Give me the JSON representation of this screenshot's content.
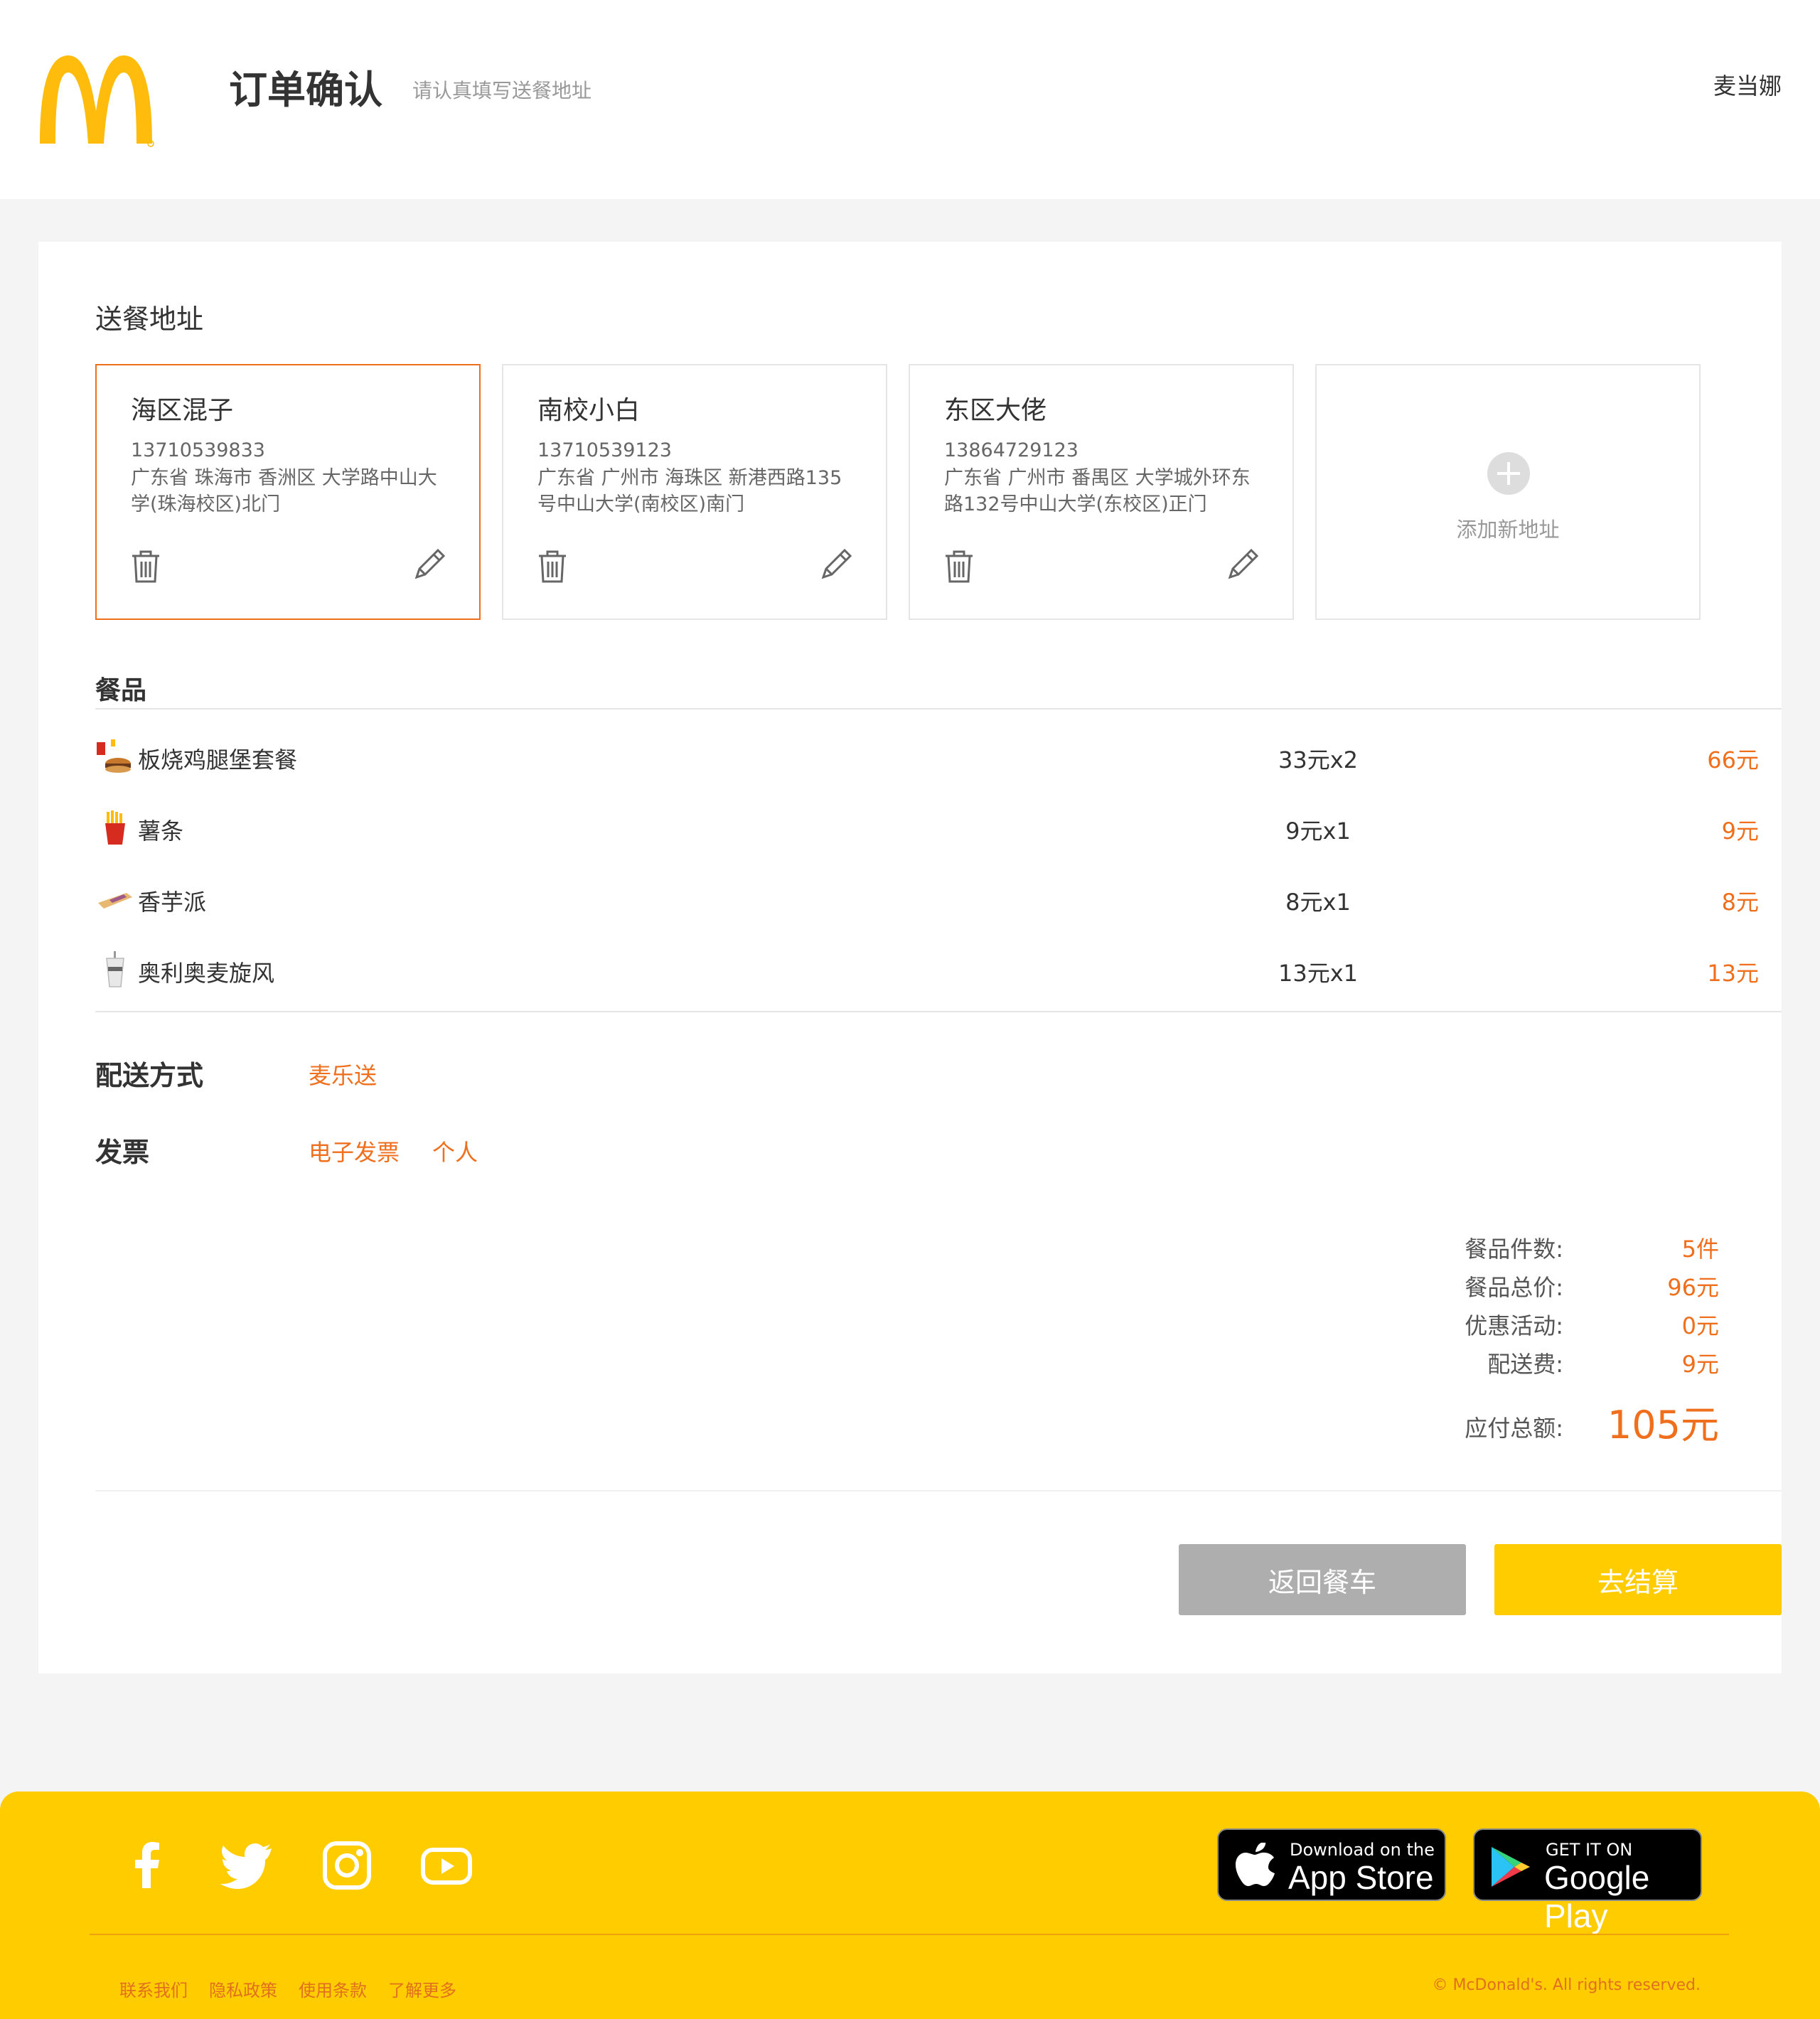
{
  "header": {
    "title": "订单确认",
    "subtitle": "请认真填写送餐地址",
    "username": "麦当娜"
  },
  "address": {
    "section_title": "送餐地址",
    "cards": [
      {
        "name": "海区混子",
        "phone": "13710539833",
        "address": "广东省 珠海市 香洲区 大学路中山大学(珠海校区)北门",
        "selected": true
      },
      {
        "name": "南校小白",
        "phone": "13710539123",
        "address": "广东省 广州市 海珠区 新港西路135号中山大学(南校区)南门",
        "selected": false
      },
      {
        "name": "东区大佬",
        "phone": "13864729123",
        "address": "广东省 广州市 番禺区 大学城外环东路132号中山大学(东校区)正门",
        "selected": false
      }
    ],
    "add_label": "添加新地址"
  },
  "items": {
    "section_title": "餐品",
    "rows": [
      {
        "icon": "burger-meal-icon",
        "name": "板烧鸡腿堡套餐",
        "qty": "33元x2",
        "total": "66元"
      },
      {
        "icon": "fries-icon",
        "name": "薯条",
        "qty": "9元x1",
        "total": "9元"
      },
      {
        "icon": "pie-icon",
        "name": "香芋派",
        "qty": "8元x1",
        "total": "8元"
      },
      {
        "icon": "mcflurry-icon",
        "name": "奥利奥麦旋风",
        "qty": "13元x1",
        "total": "13元"
      }
    ]
  },
  "delivery": {
    "label": "配送方式",
    "value": "麦乐送"
  },
  "invoice": {
    "label": "发票",
    "type": "电子发票",
    "title": "个人"
  },
  "summary": {
    "count_label": "餐品件数:",
    "count": "5件",
    "price_label": "餐品总价:",
    "price": "96元",
    "discount_label": "优惠活动:",
    "discount": "0元",
    "delivery_fee_label": "配送费:",
    "delivery_fee": "9元",
    "total_label": "应付总额:",
    "total": "105元"
  },
  "buttons": {
    "back": "返回餐车",
    "checkout": "去结算"
  },
  "footer": {
    "appstore_small": "Download on the",
    "appstore_big": "App Store",
    "googleplay_small": "GET IT ON",
    "googleplay_big": "Google Play",
    "links": [
      "联系我们",
      "隐私政策",
      "使用条款",
      "了解更多"
    ],
    "copyright": "© McDonald's. All rights reserved."
  },
  "colors": {
    "accent": "#f06f1d",
    "brand_yellow": "#ffcc00",
    "button_gray": "#aeaeae"
  }
}
